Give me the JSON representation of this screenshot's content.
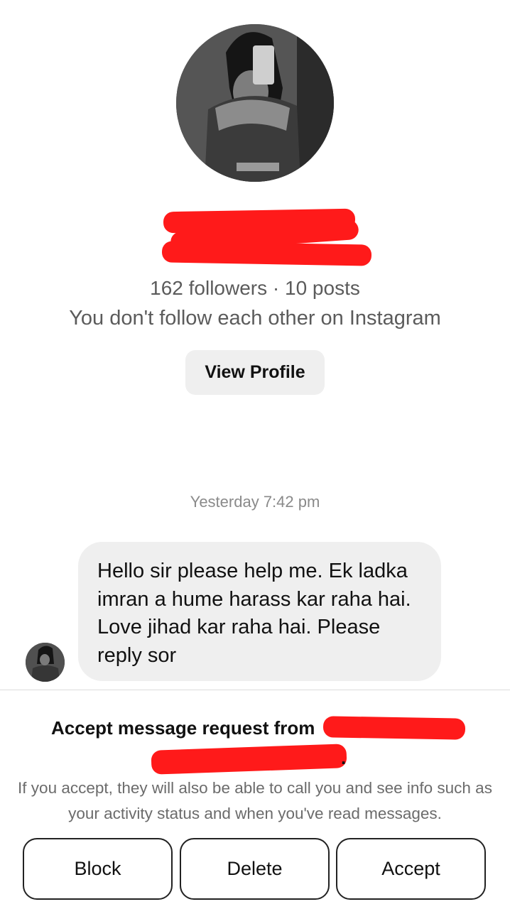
{
  "profile": {
    "stats": "162 followers · 10 posts",
    "follow_note": "You don't follow each other on Instagram",
    "view_profile_label": "View Profile"
  },
  "conversation": {
    "timestamp": "Yesterday 7:42 pm",
    "messages": [
      {
        "text": "Hello sir please help me. Ek ladka imran a hume harass kar raha hai. Love jihad kar raha hai. Please reply sor"
      }
    ]
  },
  "request_panel": {
    "title": "Accept message request from",
    "title_end": ".",
    "info": "If you accept, they will also be able to call you and see info such as your activity status and when you've read messages.",
    "buttons": {
      "block": "Block",
      "delete": "Delete",
      "accept": "Accept"
    }
  },
  "colors": {
    "redaction": "#ff1a1a",
    "bubble_bg": "#efefef",
    "secondary_text": "#5b5b5b"
  }
}
